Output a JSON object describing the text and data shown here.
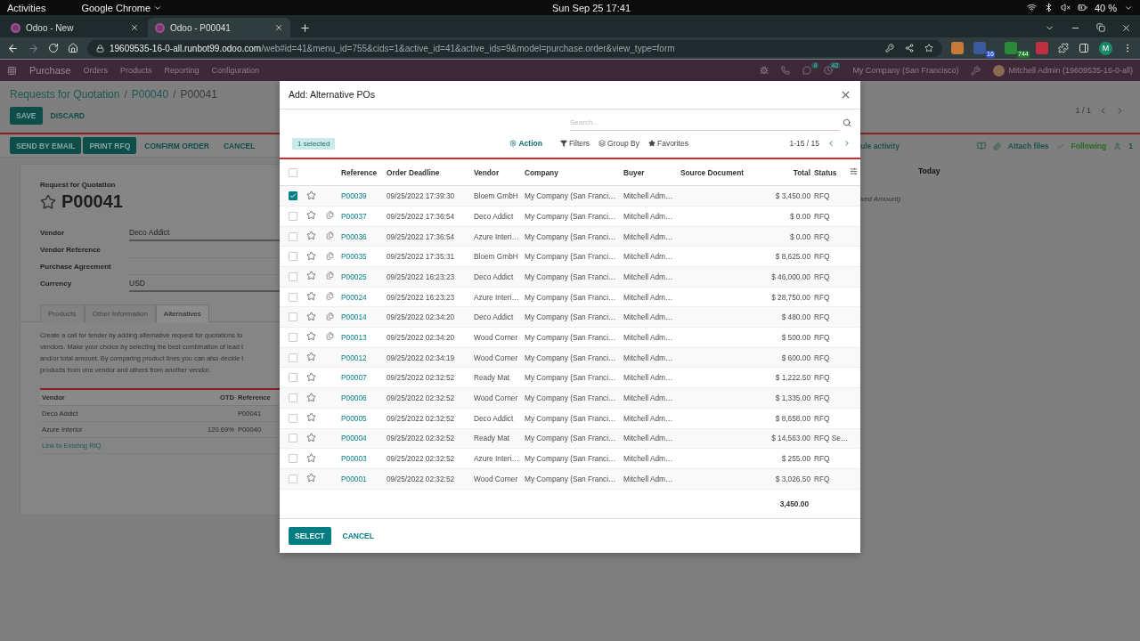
{
  "system_bar": {
    "activities": "Activities",
    "app": "Google Chrome",
    "clock": "Sun Sep 25  17:41",
    "battery": "40 %"
  },
  "browser": {
    "tabs": [
      {
        "title": "Odoo - New",
        "selected": false
      },
      {
        "title": "Odoo - P00041",
        "selected": true
      }
    ],
    "url_host": "19609535-16-0-all.runbot99.odoo.com",
    "url_path": "/web#id=41&menu_id=755&cids=1&active_id=41&active_ids=9&model=purchase.order&view_type=form",
    "extension_badges": [
      "16",
      "744"
    ],
    "profile": "M"
  },
  "navbar": {
    "app": "Purchase",
    "menus": [
      "Orders",
      "Products",
      "Reporting",
      "Configuration"
    ],
    "badges": [
      "4",
      "42"
    ],
    "company": "My Company (San Francisco)",
    "user": "Mitchell Admin (19609535-16-0-all)"
  },
  "breadcrumbs": [
    "Requests for Quotation",
    "P00040",
    "P00041"
  ],
  "breadcrumb_separator": "/",
  "form_buttons": [
    {
      "label": "SAVE",
      "primary": true
    },
    {
      "label": "DISCARD",
      "primary": false
    }
  ],
  "pager": "1 / 1",
  "status_buttons": [
    {
      "label": "SEND BY EMAIL",
      "primary": true
    },
    {
      "label": "PRINT RFQ",
      "primary": true
    },
    {
      "label": "CONFIRM ORDER",
      "primary": false
    },
    {
      "label": "CANCEL",
      "primary": false
    }
  ],
  "form": {
    "subtitle": "Request for Quotation",
    "name": "P00041",
    "starred": false,
    "fields": [
      {
        "label": "Vendor",
        "value": "Deco Addict"
      },
      {
        "label": "Vendor Reference"
      },
      {
        "label": "Purchase Agreement"
      },
      {
        "label": "Currency",
        "value": "USD"
      }
    ],
    "tabs": [
      {
        "label": "Products",
        "selected": false
      },
      {
        "label": "Other Information",
        "selected": false
      },
      {
        "label": "Alternatives",
        "selected": true
      }
    ],
    "description_lines": [
      "Create a call for tender by adding alternative request for quotations to",
      "vendors. Make your choice by selecting the best combination of lead t",
      "and/or total amount. By comparing product lines you can also decide t",
      "products from one vendor and others from another vendor."
    ],
    "alternatives": {
      "columns": [
        "Vendor",
        "OTD",
        "Reference"
      ],
      "rows": [
        {
          "vendor": "Deco Addict",
          "otd": "",
          "reference": "P00041"
        },
        {
          "vendor": "Azure Interior",
          "otd": "120.69%",
          "reference": "P00040"
        }
      ],
      "link": "Link to Existing RfQ"
    }
  },
  "chatter": {
    "activity": "ule activity",
    "attach": "Attach files",
    "following": "Following",
    "followers": "1",
    "date_separator": "Today",
    "message_fragment": "xed Amount)"
  },
  "dialog": {
    "title": "Add: Alternative POs",
    "search_placeholder": "Search...",
    "selection": "1 selected",
    "action": "Action",
    "filters": [
      "Filters",
      "Group By",
      "Favorites"
    ],
    "pager": "1-15 / 15",
    "all_checked": false,
    "columns": [
      "Reference",
      "Order Deadline",
      "Vendor",
      "Company",
      "Buyer",
      "Source Document",
      "Total",
      "Status"
    ],
    "rows": [
      {
        "reference": "P00039",
        "deadline": "09/25/2022 17:39:30",
        "vendor": "Bloem GmbH",
        "company": "My Company (San Franci…",
        "buyer": "Mitchell Adm…",
        "total": "$ 3,450.00",
        "status": "RFQ",
        "selected": true,
        "starred": false,
        "copy_icon": false
      },
      {
        "reference": "P00037",
        "deadline": "09/25/2022 17:36:54",
        "vendor": "Deco Addict",
        "company": "My Company (San Franci…",
        "buyer": "Mitchell Adm…",
        "total": "$ 0.00",
        "status": "RFQ",
        "selected": false,
        "starred": false,
        "copy_icon": true
      },
      {
        "reference": "P00036",
        "deadline": "09/25/2022 17:36:54",
        "vendor": "Azure Interi…",
        "company": "My Company (San Franci…",
        "buyer": "Mitchell Adm…",
        "total": "$ 0.00",
        "status": "RFQ",
        "selected": false,
        "starred": false,
        "copy_icon": true
      },
      {
        "reference": "P00035",
        "deadline": "09/25/2022 17:35:31",
        "vendor": "Bloem GmbH",
        "company": "My Company (San Franci…",
        "buyer": "Mitchell Adm…",
        "total": "$ 8,625.00",
        "status": "RFQ",
        "selected": false,
        "starred": false,
        "copy_icon": true
      },
      {
        "reference": "P00025",
        "deadline": "09/25/2022 16:23:23",
        "vendor": "Deco Addict",
        "company": "My Company (San Franci…",
        "buyer": "Mitchell Adm…",
        "total": "$ 46,000.00",
        "status": "RFQ",
        "selected": false,
        "starred": false,
        "copy_icon": true
      },
      {
        "reference": "P00024",
        "deadline": "09/25/2022 16:23:23",
        "vendor": "Azure Interi…",
        "company": "My Company (San Franci…",
        "buyer": "Mitchell Adm…",
        "total": "$ 28,750.00",
        "status": "RFQ",
        "selected": false,
        "starred": false,
        "copy_icon": true
      },
      {
        "reference": "P00014",
        "deadline": "09/25/2022 02:34:20",
        "vendor": "Deco Addict",
        "company": "My Company (San Franci…",
        "buyer": "Mitchell Adm…",
        "total": "$ 480.00",
        "status": "RFQ",
        "selected": false,
        "starred": false,
        "copy_icon": true
      },
      {
        "reference": "P00013",
        "deadline": "09/25/2022 02:34:20",
        "vendor": "Wood Corner",
        "company": "My Company (San Franci…",
        "buyer": "Mitchell Adm…",
        "total": "$ 500.00",
        "status": "RFQ",
        "selected": false,
        "starred": false,
        "copy_icon": true
      },
      {
        "reference": "P00012",
        "deadline": "09/25/2022 02:34:19",
        "vendor": "Wood Corner",
        "company": "My Company (San Franci…",
        "buyer": "Mitchell Adm…",
        "total": "$ 600.00",
        "status": "RFQ",
        "selected": false,
        "starred": false,
        "copy_icon": false
      },
      {
        "reference": "P00007",
        "deadline": "09/25/2022 02:32:52",
        "vendor": "Ready Mat",
        "company": "My Company (San Franci…",
        "buyer": "Mitchell Adm…",
        "total": "$ 1,222.50",
        "status": "RFQ",
        "selected": false,
        "starred": false,
        "copy_icon": false
      },
      {
        "reference": "P00006",
        "deadline": "09/25/2022 02:32:52",
        "vendor": "Wood Corner",
        "company": "My Company (San Franci…",
        "buyer": "Mitchell Adm…",
        "total": "$ 1,335.00",
        "status": "RFQ",
        "selected": false,
        "starred": false,
        "copy_icon": false
      },
      {
        "reference": "P00005",
        "deadline": "09/25/2022 02:32:52",
        "vendor": "Deco Addict",
        "company": "My Company (San Franci…",
        "buyer": "Mitchell Adm…",
        "total": "$ 8,658.00",
        "status": "RFQ",
        "selected": false,
        "starred": false,
        "copy_icon": false
      },
      {
        "reference": "P00004",
        "deadline": "09/25/2022 02:32:52",
        "vendor": "Ready Mat",
        "company": "My Company (San Franci…",
        "buyer": "Mitchell Adm…",
        "total": "$ 14,563.00",
        "status": "RFQ Se…",
        "selected": false,
        "starred": false,
        "copy_icon": false
      },
      {
        "reference": "P00003",
        "deadline": "09/25/2022 02:32:52",
        "vendor": "Azure Interi…",
        "company": "My Company (San Franci…",
        "buyer": "Mitchell Adm…",
        "total": "$ 255.00",
        "status": "RFQ",
        "selected": false,
        "starred": false,
        "copy_icon": false
      },
      {
        "reference": "P00001",
        "deadline": "09/25/2022 02:32:52",
        "vendor": "Wood Corner",
        "company": "My Company (San Franci…",
        "buyer": "Mitchell Adm…",
        "total": "$ 3,026.50",
        "status": "RFQ",
        "selected": false,
        "starred": false,
        "copy_icon": false
      }
    ],
    "footer_total": "3,450.00",
    "buttons": [
      {
        "label": "SELECT",
        "primary": true
      },
      {
        "label": "CANCEL",
        "primary": false
      }
    ]
  }
}
